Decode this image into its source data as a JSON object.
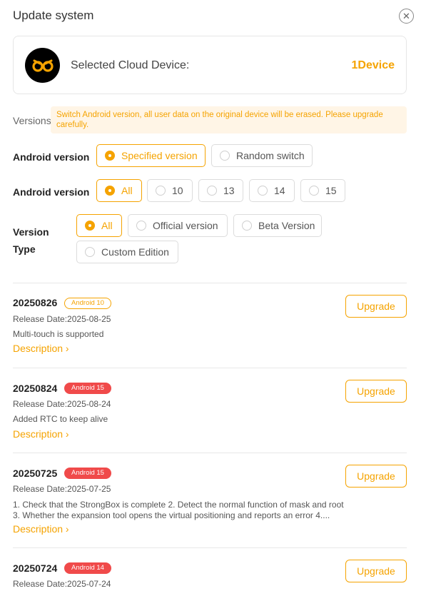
{
  "header": {
    "title": "Update system"
  },
  "device": {
    "label": "Selected Cloud Device:",
    "count": "1Device"
  },
  "versions": {
    "label": "Versions:",
    "warning": "Switch Android version, all user data on the original device will be erased. Please upgrade carefully."
  },
  "filters": {
    "android_mode": {
      "label": "Android version",
      "options": [
        "Specified version",
        "Random switch"
      ],
      "selected": "Specified version"
    },
    "android_version": {
      "label": "Android version",
      "options": [
        "All",
        "10",
        "13",
        "14",
        "15"
      ],
      "selected": "All"
    },
    "version_type": {
      "label_line1": "Version",
      "label_line2": "Type",
      "options": [
        "All",
        "Official version",
        "Beta Version",
        "Custom Edition"
      ],
      "selected": "All"
    }
  },
  "updates": [
    {
      "version": "20250826",
      "badge": "Android 10",
      "release": "Release Date:2025-08-25",
      "description": "Multi-touch is supported",
      "description_link": "Description",
      "upgrade": "Upgrade"
    },
    {
      "version": "20250824",
      "badge": "Android 15",
      "release": "Release Date:2025-08-24",
      "description": "Added RTC to keep alive",
      "description_link": "Description",
      "upgrade": "Upgrade"
    },
    {
      "version": "20250725",
      "badge": "Android 15",
      "release": "Release Date:2025-07-25",
      "description": "1. Check that the StrongBox is complete 2. Detect the normal function of mask and root 3. Whether the expansion tool opens the virtual positioning and reports an error 4....",
      "description_link": "Description",
      "upgrade": "Upgrade"
    },
    {
      "version": "20250724",
      "badge": "Android 14",
      "release": "Release Date:2025-07-24",
      "upgrade": "Upgrade"
    }
  ],
  "colors": {
    "accent": "#f5a300",
    "badge_red": "#f04a4a",
    "warning_bg": "#fff5e6"
  },
  "icons": {
    "close": "close-circle-icon",
    "logo": "cloud-device-logo",
    "chevron": "chevron-right-icon"
  }
}
